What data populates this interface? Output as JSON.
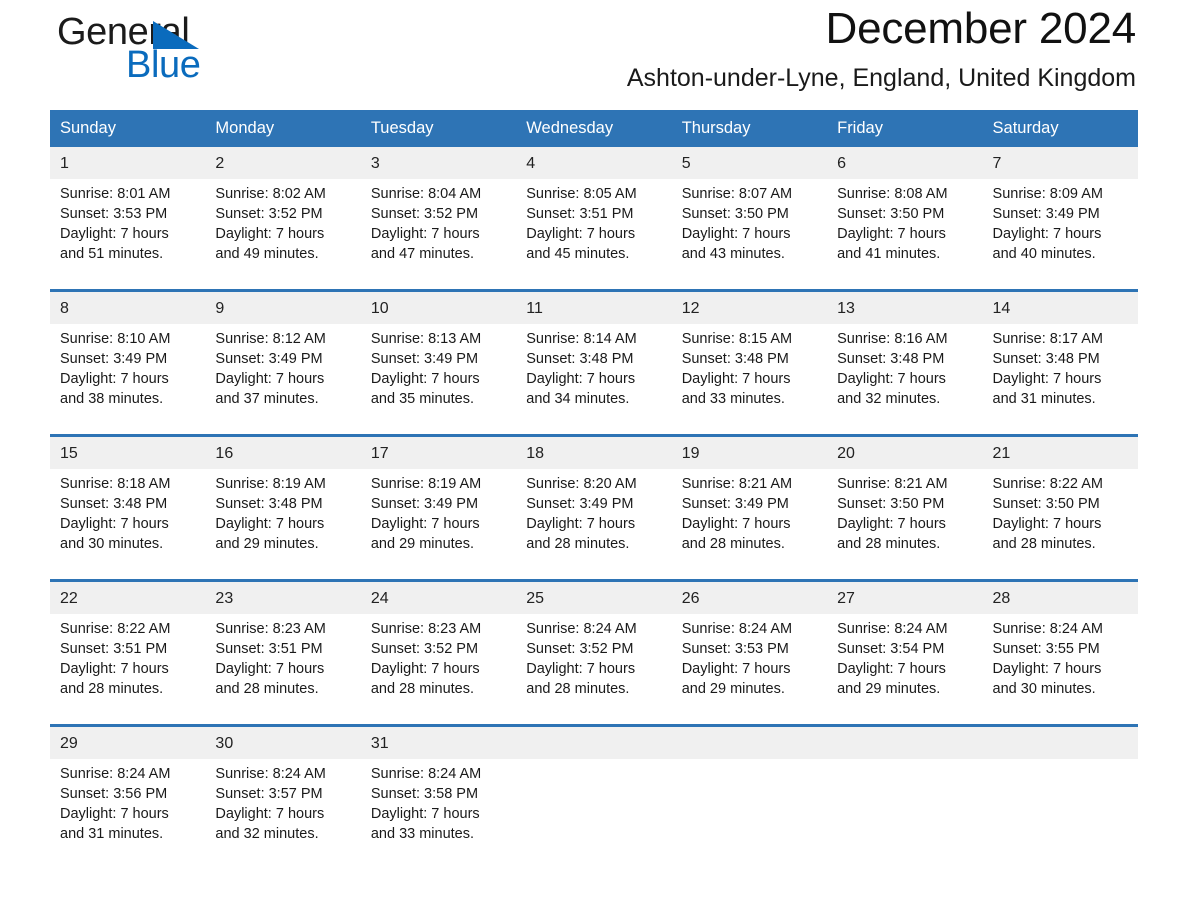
{
  "brand": {
    "word_one": "General",
    "word_two": "Blue",
    "flag_icon": "blue-triangle-flag-icon"
  },
  "header": {
    "month_title": "December 2024",
    "location": "Ashton-under-Lyne, England, United Kingdom"
  },
  "colors": {
    "header_blue": "#2e74b5",
    "brand_blue": "#0a6bbd",
    "daynum_band": "#f0f0f0",
    "text": "#1a1a1a",
    "page_background": "#ffffff"
  },
  "calendar": {
    "day_headers": [
      "Sunday",
      "Monday",
      "Tuesday",
      "Wednesday",
      "Thursday",
      "Friday",
      "Saturday"
    ],
    "weeks": [
      {
        "days": [
          {
            "num": "1",
            "sunrise": "Sunrise: 8:01 AM",
            "sunset": "Sunset: 3:53 PM",
            "daylight_line1": "Daylight: 7 hours",
            "daylight_line2": "and 51 minutes."
          },
          {
            "num": "2",
            "sunrise": "Sunrise: 8:02 AM",
            "sunset": "Sunset: 3:52 PM",
            "daylight_line1": "Daylight: 7 hours",
            "daylight_line2": "and 49 minutes."
          },
          {
            "num": "3",
            "sunrise": "Sunrise: 8:04 AM",
            "sunset": "Sunset: 3:52 PM",
            "daylight_line1": "Daylight: 7 hours",
            "daylight_line2": "and 47 minutes."
          },
          {
            "num": "4",
            "sunrise": "Sunrise: 8:05 AM",
            "sunset": "Sunset: 3:51 PM",
            "daylight_line1": "Daylight: 7 hours",
            "daylight_line2": "and 45 minutes."
          },
          {
            "num": "5",
            "sunrise": "Sunrise: 8:07 AM",
            "sunset": "Sunset: 3:50 PM",
            "daylight_line1": "Daylight: 7 hours",
            "daylight_line2": "and 43 minutes."
          },
          {
            "num": "6",
            "sunrise": "Sunrise: 8:08 AM",
            "sunset": "Sunset: 3:50 PM",
            "daylight_line1": "Daylight: 7 hours",
            "daylight_line2": "and 41 minutes."
          },
          {
            "num": "7",
            "sunrise": "Sunrise: 8:09 AM",
            "sunset": "Sunset: 3:49 PM",
            "daylight_line1": "Daylight: 7 hours",
            "daylight_line2": "and 40 minutes."
          }
        ]
      },
      {
        "days": [
          {
            "num": "8",
            "sunrise": "Sunrise: 8:10 AM",
            "sunset": "Sunset: 3:49 PM",
            "daylight_line1": "Daylight: 7 hours",
            "daylight_line2": "and 38 minutes."
          },
          {
            "num": "9",
            "sunrise": "Sunrise: 8:12 AM",
            "sunset": "Sunset: 3:49 PM",
            "daylight_line1": "Daylight: 7 hours",
            "daylight_line2": "and 37 minutes."
          },
          {
            "num": "10",
            "sunrise": "Sunrise: 8:13 AM",
            "sunset": "Sunset: 3:49 PM",
            "daylight_line1": "Daylight: 7 hours",
            "daylight_line2": "and 35 minutes."
          },
          {
            "num": "11",
            "sunrise": "Sunrise: 8:14 AM",
            "sunset": "Sunset: 3:48 PM",
            "daylight_line1": "Daylight: 7 hours",
            "daylight_line2": "and 34 minutes."
          },
          {
            "num": "12",
            "sunrise": "Sunrise: 8:15 AM",
            "sunset": "Sunset: 3:48 PM",
            "daylight_line1": "Daylight: 7 hours",
            "daylight_line2": "and 33 minutes."
          },
          {
            "num": "13",
            "sunrise": "Sunrise: 8:16 AM",
            "sunset": "Sunset: 3:48 PM",
            "daylight_line1": "Daylight: 7 hours",
            "daylight_line2": "and 32 minutes."
          },
          {
            "num": "14",
            "sunrise": "Sunrise: 8:17 AM",
            "sunset": "Sunset: 3:48 PM",
            "daylight_line1": "Daylight: 7 hours",
            "daylight_line2": "and 31 minutes."
          }
        ]
      },
      {
        "days": [
          {
            "num": "15",
            "sunrise": "Sunrise: 8:18 AM",
            "sunset": "Sunset: 3:48 PM",
            "daylight_line1": "Daylight: 7 hours",
            "daylight_line2": "and 30 minutes."
          },
          {
            "num": "16",
            "sunrise": "Sunrise: 8:19 AM",
            "sunset": "Sunset: 3:48 PM",
            "daylight_line1": "Daylight: 7 hours",
            "daylight_line2": "and 29 minutes."
          },
          {
            "num": "17",
            "sunrise": "Sunrise: 8:19 AM",
            "sunset": "Sunset: 3:49 PM",
            "daylight_line1": "Daylight: 7 hours",
            "daylight_line2": "and 29 minutes."
          },
          {
            "num": "18",
            "sunrise": "Sunrise: 8:20 AM",
            "sunset": "Sunset: 3:49 PM",
            "daylight_line1": "Daylight: 7 hours",
            "daylight_line2": "and 28 minutes."
          },
          {
            "num": "19",
            "sunrise": "Sunrise: 8:21 AM",
            "sunset": "Sunset: 3:49 PM",
            "daylight_line1": "Daylight: 7 hours",
            "daylight_line2": "and 28 minutes."
          },
          {
            "num": "20",
            "sunrise": "Sunrise: 8:21 AM",
            "sunset": "Sunset: 3:50 PM",
            "daylight_line1": "Daylight: 7 hours",
            "daylight_line2": "and 28 minutes."
          },
          {
            "num": "21",
            "sunrise": "Sunrise: 8:22 AM",
            "sunset": "Sunset: 3:50 PM",
            "daylight_line1": "Daylight: 7 hours",
            "daylight_line2": "and 28 minutes."
          }
        ]
      },
      {
        "days": [
          {
            "num": "22",
            "sunrise": "Sunrise: 8:22 AM",
            "sunset": "Sunset: 3:51 PM",
            "daylight_line1": "Daylight: 7 hours",
            "daylight_line2": "and 28 minutes."
          },
          {
            "num": "23",
            "sunrise": "Sunrise: 8:23 AM",
            "sunset": "Sunset: 3:51 PM",
            "daylight_line1": "Daylight: 7 hours",
            "daylight_line2": "and 28 minutes."
          },
          {
            "num": "24",
            "sunrise": "Sunrise: 8:23 AM",
            "sunset": "Sunset: 3:52 PM",
            "daylight_line1": "Daylight: 7 hours",
            "daylight_line2": "and 28 minutes."
          },
          {
            "num": "25",
            "sunrise": "Sunrise: 8:24 AM",
            "sunset": "Sunset: 3:52 PM",
            "daylight_line1": "Daylight: 7 hours",
            "daylight_line2": "and 28 minutes."
          },
          {
            "num": "26",
            "sunrise": "Sunrise: 8:24 AM",
            "sunset": "Sunset: 3:53 PM",
            "daylight_line1": "Daylight: 7 hours",
            "daylight_line2": "and 29 minutes."
          },
          {
            "num": "27",
            "sunrise": "Sunrise: 8:24 AM",
            "sunset": "Sunset: 3:54 PM",
            "daylight_line1": "Daylight: 7 hours",
            "daylight_line2": "and 29 minutes."
          },
          {
            "num": "28",
            "sunrise": "Sunrise: 8:24 AM",
            "sunset": "Sunset: 3:55 PM",
            "daylight_line1": "Daylight: 7 hours",
            "daylight_line2": "and 30 minutes."
          }
        ]
      },
      {
        "days": [
          {
            "num": "29",
            "sunrise": "Sunrise: 8:24 AM",
            "sunset": "Sunset: 3:56 PM",
            "daylight_line1": "Daylight: 7 hours",
            "daylight_line2": "and 31 minutes."
          },
          {
            "num": "30",
            "sunrise": "Sunrise: 8:24 AM",
            "sunset": "Sunset: 3:57 PM",
            "daylight_line1": "Daylight: 7 hours",
            "daylight_line2": "and 32 minutes."
          },
          {
            "num": "31",
            "sunrise": "Sunrise: 8:24 AM",
            "sunset": "Sunset: 3:58 PM",
            "daylight_line1": "Daylight: 7 hours",
            "daylight_line2": "and 33 minutes."
          },
          {
            "num": "",
            "sunrise": "",
            "sunset": "",
            "daylight_line1": "",
            "daylight_line2": ""
          },
          {
            "num": "",
            "sunrise": "",
            "sunset": "",
            "daylight_line1": "",
            "daylight_line2": ""
          },
          {
            "num": "",
            "sunrise": "",
            "sunset": "",
            "daylight_line1": "",
            "daylight_line2": ""
          },
          {
            "num": "",
            "sunrise": "",
            "sunset": "",
            "daylight_line1": "",
            "daylight_line2": ""
          }
        ]
      }
    ]
  }
}
